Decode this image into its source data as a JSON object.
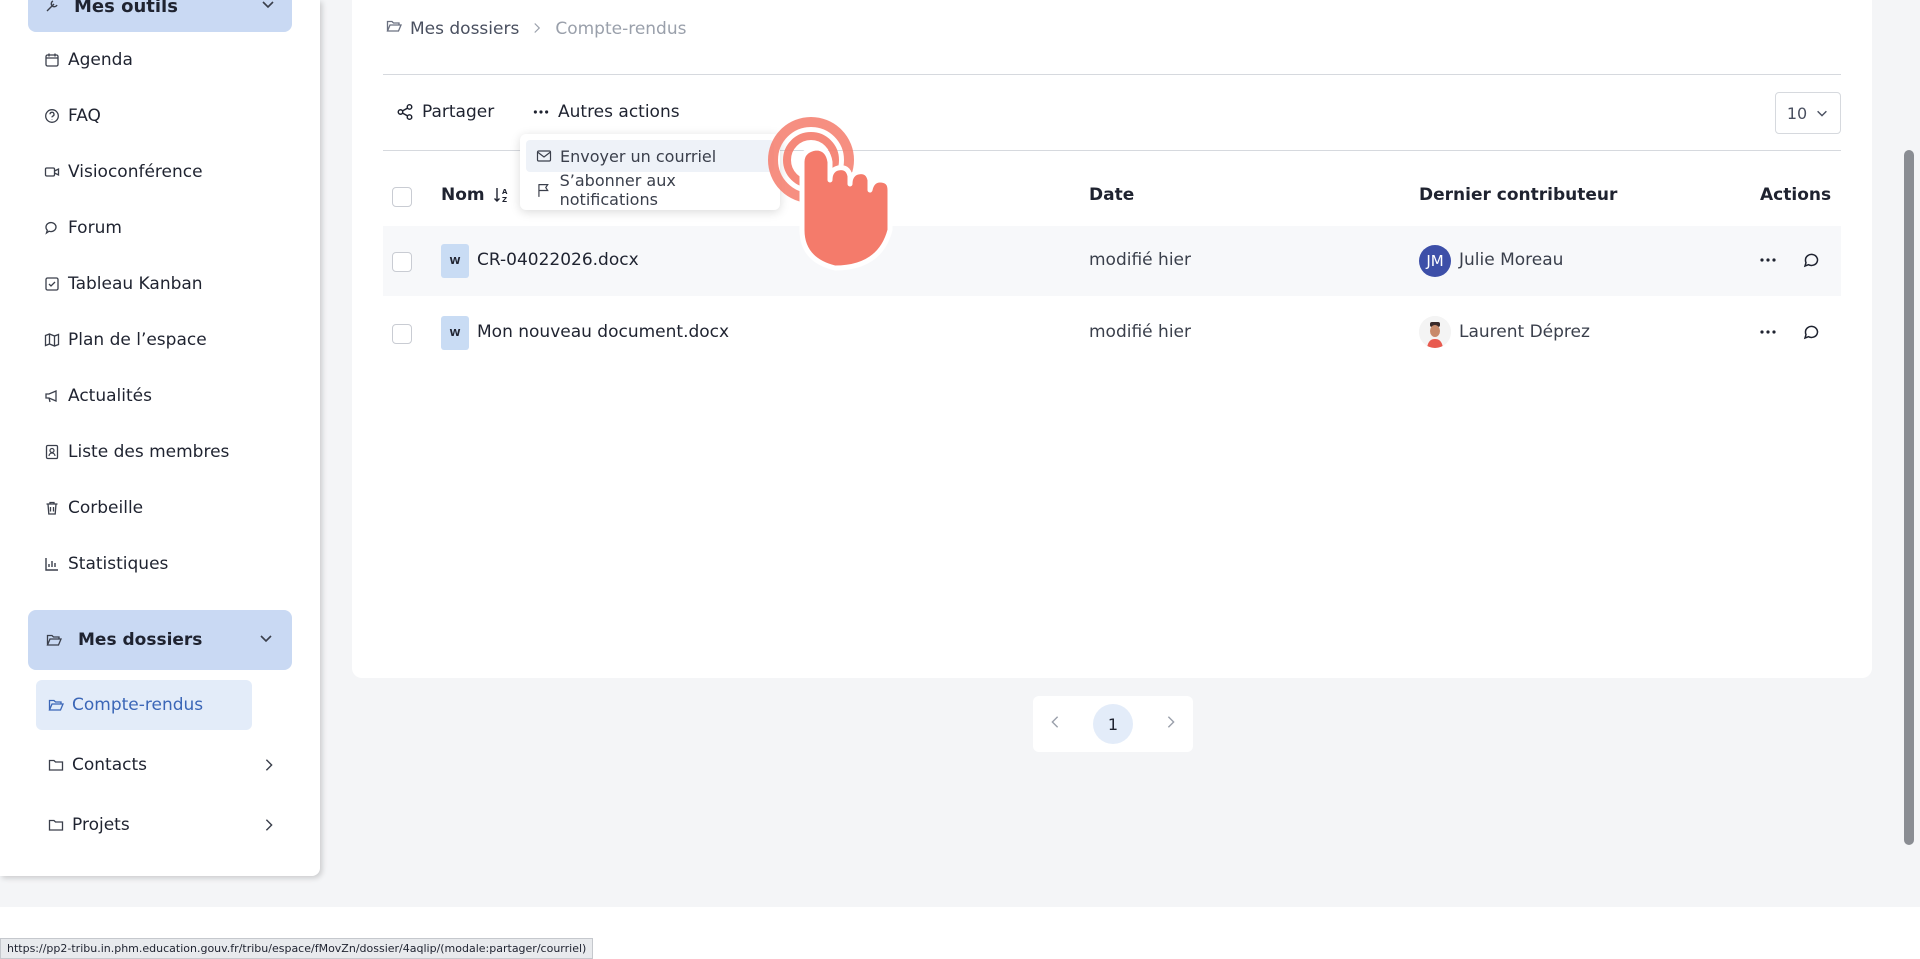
{
  "sidebar": {
    "tools_header": "Mes outils",
    "items": [
      {
        "label": "Agenda",
        "icon": "calendar-icon"
      },
      {
        "label": "FAQ",
        "icon": "help-icon"
      },
      {
        "label": "Visioconférence",
        "icon": "video-icon"
      },
      {
        "label": "Forum",
        "icon": "forum-icon"
      },
      {
        "label": "Tableau Kanban",
        "icon": "kanban-icon"
      },
      {
        "label": "Plan de l’espace",
        "icon": "map-icon"
      },
      {
        "label": "Actualités",
        "icon": "megaphone-icon"
      },
      {
        "label": "Liste des membres",
        "icon": "members-icon"
      },
      {
        "label": "Corbeille",
        "icon": "trash-icon"
      },
      {
        "label": "Statistiques",
        "icon": "stats-icon"
      }
    ],
    "folders_header": "Mes dossiers",
    "folders": [
      {
        "label": "Compte-rendus",
        "active": true
      },
      {
        "label": "Contacts"
      },
      {
        "label": "Projets"
      }
    ]
  },
  "breadcrumb": {
    "root": "Mes dossiers",
    "current": "Compte-rendus"
  },
  "toolbar": {
    "share_label": "Partager",
    "more_label": "Autres actions",
    "per_page": "10"
  },
  "dropdown": {
    "items": [
      {
        "label": "Envoyer un courriel",
        "icon": "mail-icon"
      },
      {
        "label": "S’abonner aux notifications",
        "icon": "flag-icon"
      }
    ]
  },
  "table": {
    "headers": {
      "name": "Nom",
      "date": "Date",
      "contributor": "Dernier contributeur",
      "actions": "Actions"
    },
    "rows": [
      {
        "badge": "W",
        "name": "CR-04022026.docx",
        "date": "modifié hier",
        "contributor": "Julie Moreau",
        "initials": "JM"
      },
      {
        "badge": "W",
        "name": "Mon nouveau document.docx",
        "date": "modifié hier",
        "contributor": "Laurent Déprez",
        "initials": ""
      }
    ]
  },
  "pagination": {
    "current": "1"
  },
  "status_url": "https://pp2-tribu.in.phm.education.gouv.fr/tribu/espace/fMovZn/dossier/4aqlip/(modale:partager/courriel)",
  "colors": {
    "accent_light": "#c9d9f3",
    "accent_text": "#3b66b7",
    "avatar_jm": "#3d4fa8",
    "cursor_hand": "#f47b6b"
  }
}
